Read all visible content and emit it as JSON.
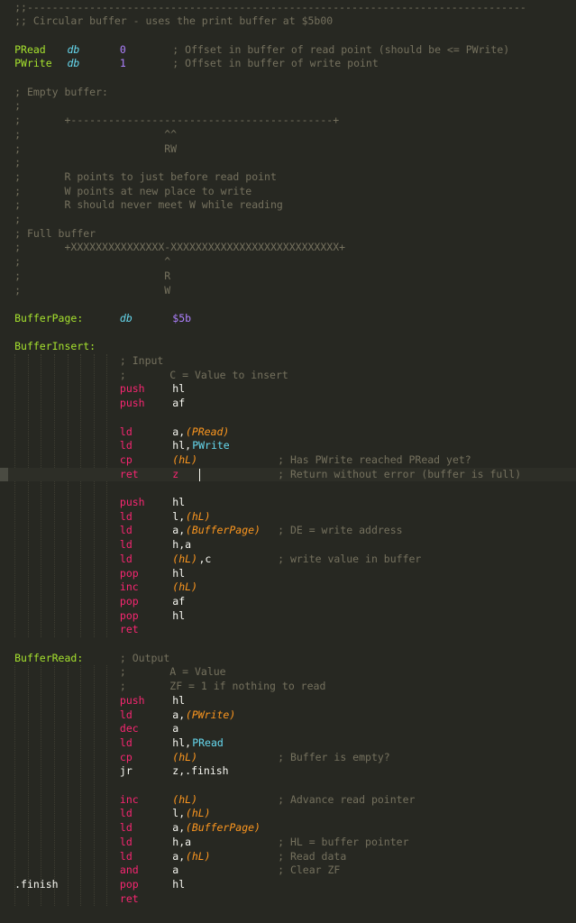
{
  "lines": [
    {
      "tokens": [
        {
          "col": 2,
          "t": "comment",
          "text": ";;--------------------------------------------------------------------------------"
        }
      ]
    },
    {
      "tokens": [
        {
          "col": 2,
          "t": "comment",
          "text": ";; Circular buffer - uses the print buffer at $5b00"
        }
      ]
    },
    {
      "tokens": []
    },
    {
      "tokens": [
        {
          "col": 2,
          "t": "label",
          "text": "PRead"
        },
        {
          "col": 10,
          "t": "dir",
          "text": "db"
        },
        {
          "col": 18,
          "t": "num",
          "text": "0"
        },
        {
          "col": 26,
          "t": "comment",
          "text": "; Offset in buffer of read point (should be <= PWrite)"
        }
      ]
    },
    {
      "tokens": [
        {
          "col": 2,
          "t": "label",
          "text": "PWrite"
        },
        {
          "col": 10,
          "t": "dir",
          "text": "db"
        },
        {
          "col": 18,
          "t": "num",
          "text": "1"
        },
        {
          "col": 26,
          "t": "comment",
          "text": "; Offset in buffer of write point"
        }
      ]
    },
    {
      "tokens": []
    },
    {
      "tokens": [
        {
          "col": 2,
          "t": "comment",
          "text": "; Empty buffer:"
        }
      ]
    },
    {
      "tokens": [
        {
          "col": 2,
          "t": "comment",
          "text": ";"
        }
      ]
    },
    {
      "tokens": [
        {
          "col": 2,
          "t": "comment",
          "text": ";       +------------------------------------------+"
        }
      ]
    },
    {
      "tokens": [
        {
          "col": 2,
          "t": "comment",
          "text": ";                       ^^"
        }
      ]
    },
    {
      "tokens": [
        {
          "col": 2,
          "t": "comment",
          "text": ";                       RW"
        }
      ]
    },
    {
      "tokens": [
        {
          "col": 2,
          "t": "comment",
          "text": ";"
        }
      ]
    },
    {
      "tokens": [
        {
          "col": 2,
          "t": "comment",
          "text": ";       R points to just before read point"
        }
      ]
    },
    {
      "tokens": [
        {
          "col": 2,
          "t": "comment",
          "text": ";       W points at new place to write"
        }
      ]
    },
    {
      "tokens": [
        {
          "col": 2,
          "t": "comment",
          "text": ";       R should never meet W while reading"
        }
      ]
    },
    {
      "tokens": [
        {
          "col": 2,
          "t": "comment",
          "text": ";"
        }
      ]
    },
    {
      "tokens": [
        {
          "col": 2,
          "t": "comment",
          "text": "; Full buffer"
        }
      ]
    },
    {
      "tokens": [
        {
          "col": 2,
          "t": "comment",
          "text": ";       +XXXXXXXXXXXXXXX-XXXXXXXXXXXXXXXXXXXXXXXXXXX+"
        }
      ]
    },
    {
      "tokens": [
        {
          "col": 2,
          "t": "comment",
          "text": ";                       ^"
        }
      ]
    },
    {
      "tokens": [
        {
          "col": 2,
          "t": "comment",
          "text": ";                       R"
        }
      ]
    },
    {
      "tokens": [
        {
          "col": 2,
          "t": "comment",
          "text": ";                       W"
        }
      ]
    },
    {
      "tokens": []
    },
    {
      "tokens": [
        {
          "col": 2,
          "t": "label",
          "text": "BufferPage:"
        },
        {
          "col": 18,
          "t": "dir",
          "text": "db"
        },
        {
          "col": 26,
          "t": "num",
          "text": "$5b"
        }
      ]
    },
    {
      "tokens": []
    },
    {
      "tokens": [
        {
          "col": 2,
          "t": "label",
          "text": "BufferInsert:"
        }
      ]
    },
    {
      "tokens": [
        {
          "col": 18,
          "t": "comment",
          "text": "; Input"
        }
      ]
    },
    {
      "tokens": [
        {
          "col": 18,
          "t": "comment",
          "text": ";       C = Value to insert"
        }
      ]
    },
    {
      "tokens": [
        {
          "col": 18,
          "t": "kw",
          "text": "push"
        },
        {
          "col": 26,
          "t": "op",
          "text": "hl"
        }
      ]
    },
    {
      "tokens": [
        {
          "col": 18,
          "t": "kw",
          "text": "push"
        },
        {
          "col": 26,
          "t": "op",
          "text": "af"
        }
      ]
    },
    {
      "tokens": []
    },
    {
      "tokens": [
        {
          "col": 18,
          "t": "kw",
          "text": "ld"
        },
        {
          "col": 26,
          "t": "op",
          "text": "a,"
        },
        {
          "col": 28,
          "t": "mem",
          "text": "(PRead)"
        }
      ]
    },
    {
      "tokens": [
        {
          "col": 18,
          "t": "kw",
          "text": "ld"
        },
        {
          "col": 26,
          "t": "op",
          "text": "hl,"
        },
        {
          "col": 29,
          "t": "const",
          "text": "PWrite"
        }
      ]
    },
    {
      "tokens": [
        {
          "col": 18,
          "t": "kw",
          "text": "cp"
        },
        {
          "col": 26,
          "t": "mem",
          "text": "(hL)"
        },
        {
          "col": 42,
          "t": "comment",
          "text": "; Has PWrite reached PRead yet?"
        }
      ]
    },
    {
      "current": true,
      "tokens": [
        {
          "col": 18,
          "t": "kw",
          "text": "ret"
        },
        {
          "col": 26,
          "t": "kw",
          "text": "z"
        },
        {
          "col": 42,
          "t": "comment",
          "text": "; Return without error (buffer is full)"
        }
      ]
    },
    {
      "tokens": []
    },
    {
      "tokens": [
        {
          "col": 18,
          "t": "kw",
          "text": "push"
        },
        {
          "col": 26,
          "t": "op",
          "text": "hl"
        }
      ]
    },
    {
      "tokens": [
        {
          "col": 18,
          "t": "kw",
          "text": "ld"
        },
        {
          "col": 26,
          "t": "op",
          "text": "l,"
        },
        {
          "col": 28,
          "t": "mem",
          "text": "(hL)"
        }
      ]
    },
    {
      "tokens": [
        {
          "col": 18,
          "t": "kw",
          "text": "ld"
        },
        {
          "col": 26,
          "t": "op",
          "text": "a,"
        },
        {
          "col": 28,
          "t": "mem",
          "text": "(BufferPage)"
        },
        {
          "col": 42,
          "t": "comment",
          "text": "; DE = write address"
        }
      ]
    },
    {
      "tokens": [
        {
          "col": 18,
          "t": "kw",
          "text": "ld"
        },
        {
          "col": 26,
          "t": "op",
          "text": "h,a"
        }
      ]
    },
    {
      "tokens": [
        {
          "col": 18,
          "t": "kw",
          "text": "ld"
        },
        {
          "col": 26,
          "t": "mem",
          "text": "(hL)"
        },
        {
          "col": 30,
          "t": "op",
          "text": ",c"
        },
        {
          "col": 42,
          "t": "comment",
          "text": "; write value in buffer"
        }
      ]
    },
    {
      "tokens": [
        {
          "col": 18,
          "t": "kw",
          "text": "pop"
        },
        {
          "col": 26,
          "t": "op",
          "text": "hl"
        }
      ]
    },
    {
      "tokens": [
        {
          "col": 18,
          "t": "kw",
          "text": "inc"
        },
        {
          "col": 26,
          "t": "mem",
          "text": "(hL)"
        }
      ]
    },
    {
      "tokens": [
        {
          "col": 18,
          "t": "kw",
          "text": "pop"
        },
        {
          "col": 26,
          "t": "op",
          "text": "af"
        }
      ]
    },
    {
      "tokens": [
        {
          "col": 18,
          "t": "kw",
          "text": "pop"
        },
        {
          "col": 26,
          "t": "op",
          "text": "hl"
        }
      ]
    },
    {
      "tokens": [
        {
          "col": 18,
          "t": "kw",
          "text": "ret"
        }
      ]
    },
    {
      "tokens": []
    },
    {
      "tokens": [
        {
          "col": 2,
          "t": "label",
          "text": "BufferRead:"
        },
        {
          "col": 18,
          "t": "comment",
          "text": "; Output"
        }
      ]
    },
    {
      "tokens": [
        {
          "col": 18,
          "t": "comment",
          "text": ";       A = Value"
        }
      ]
    },
    {
      "tokens": [
        {
          "col": 18,
          "t": "comment",
          "text": ";       ZF = 1 if nothing to read"
        }
      ]
    },
    {
      "tokens": [
        {
          "col": 18,
          "t": "kw",
          "text": "push"
        },
        {
          "col": 26,
          "t": "op",
          "text": "hl"
        }
      ]
    },
    {
      "tokens": [
        {
          "col": 18,
          "t": "kw",
          "text": "ld"
        },
        {
          "col": 26,
          "t": "op",
          "text": "a,"
        },
        {
          "col": 28,
          "t": "mem",
          "text": "(PWrite)"
        }
      ]
    },
    {
      "tokens": [
        {
          "col": 18,
          "t": "kw",
          "text": "dec"
        },
        {
          "col": 26,
          "t": "op",
          "text": "a"
        }
      ]
    },
    {
      "tokens": [
        {
          "col": 18,
          "t": "kw",
          "text": "ld"
        },
        {
          "col": 26,
          "t": "op",
          "text": "hl,"
        },
        {
          "col": 29,
          "t": "const",
          "text": "PRead"
        }
      ]
    },
    {
      "tokens": [
        {
          "col": 18,
          "t": "kw",
          "text": "cp"
        },
        {
          "col": 26,
          "t": "mem",
          "text": "(hL)"
        },
        {
          "col": 42,
          "t": "comment",
          "text": "; Buffer is empty?"
        }
      ]
    },
    {
      "tokens": [
        {
          "col": 18,
          "t": "op",
          "text": "jr"
        },
        {
          "col": 26,
          "t": "op",
          "text": "z,.finish"
        }
      ]
    },
    {
      "tokens": []
    },
    {
      "tokens": [
        {
          "col": 18,
          "t": "kw",
          "text": "inc"
        },
        {
          "col": 26,
          "t": "mem",
          "text": "(hL)"
        },
        {
          "col": 42,
          "t": "comment",
          "text": "; Advance read pointer"
        }
      ]
    },
    {
      "tokens": [
        {
          "col": 18,
          "t": "kw",
          "text": "ld"
        },
        {
          "col": 26,
          "t": "op",
          "text": "l,"
        },
        {
          "col": 28,
          "t": "mem",
          "text": "(hL)"
        }
      ]
    },
    {
      "tokens": [
        {
          "col": 18,
          "t": "kw",
          "text": "ld"
        },
        {
          "col": 26,
          "t": "op",
          "text": "a,"
        },
        {
          "col": 28,
          "t": "mem",
          "text": "(BufferPage)"
        }
      ]
    },
    {
      "tokens": [
        {
          "col": 18,
          "t": "kw",
          "text": "ld"
        },
        {
          "col": 26,
          "t": "op",
          "text": "h,a"
        },
        {
          "col": 42,
          "t": "comment",
          "text": "; HL = buffer pointer"
        }
      ]
    },
    {
      "tokens": [
        {
          "col": 18,
          "t": "kw",
          "text": "ld"
        },
        {
          "col": 26,
          "t": "op",
          "text": "a,"
        },
        {
          "col": 28,
          "t": "mem",
          "text": "(hL)"
        },
        {
          "col": 42,
          "t": "comment",
          "text": "; Read data"
        }
      ]
    },
    {
      "tokens": [
        {
          "col": 18,
          "t": "kw",
          "text": "and"
        },
        {
          "col": 26,
          "t": "op",
          "text": "a"
        },
        {
          "col": 42,
          "t": "comment",
          "text": "; Clear ZF"
        }
      ]
    },
    {
      "tokens": [
        {
          "col": 2,
          "t": "op",
          "text": ".finish"
        },
        {
          "col": 18,
          "t": "kw",
          "text": "pop"
        },
        {
          "col": 26,
          "t": "op",
          "text": "hl"
        }
      ]
    },
    {
      "tokens": [
        {
          "col": 18,
          "t": "kw",
          "text": "ret"
        }
      ]
    }
  ],
  "current_line": 33,
  "caret_col": 30
}
